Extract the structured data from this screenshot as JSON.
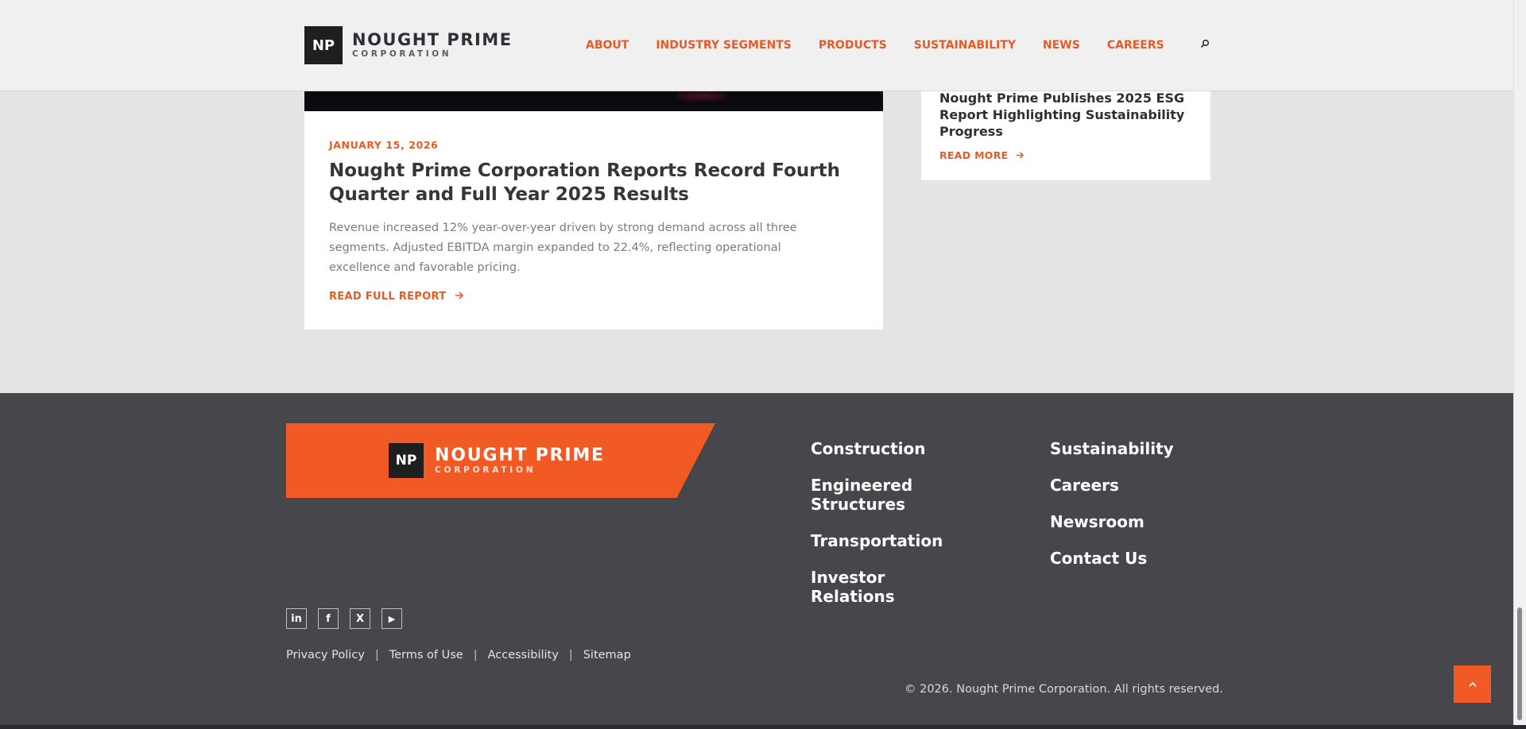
{
  "header": {
    "logo_mark": "NP",
    "logo_name": "NOUGHT PRIME",
    "logo_sub": "CORPORATION",
    "nav": [
      "ABOUT",
      "INDUSTRY SEGMENTS",
      "PRODUCTS",
      "SUSTAINABILITY",
      "NEWS",
      "CAREERS"
    ]
  },
  "featured": {
    "date": "JANUARY 15, 2026",
    "title": "Nought Prime Corporation Reports Record Fourth Quarter and Full Year 2025 Results",
    "excerpt": "Revenue increased 12% year-over-year driven by strong demand across all three segments. Adjusted EBITDA margin expanded to 22.4%, reflecting operational excellence and favorable pricing.",
    "link": "READ FULL REPORT"
  },
  "side": {
    "title": "Nought Prime Publishes 2025 ESG Report Highlighting Sustainability Progress",
    "link": "READ MORE"
  },
  "footer": {
    "logo_mark": "NP",
    "logo_name": "NOUGHT PRIME",
    "logo_sub": "CORPORATION",
    "col1": [
      "Construction",
      "Engineered Structures",
      "Transportation",
      "Investor Relations"
    ],
    "col2": [
      "Sustainability",
      "Careers",
      "Newsroom",
      "Contact Us"
    ],
    "social": [
      "in",
      "f",
      "X",
      "▶"
    ],
    "legal": [
      "Privacy Policy",
      "Terms of Use",
      "Accessibility",
      "Sitemap"
    ],
    "separator": "|",
    "copyright": "© 2026. Nought Prime Corporation. All rights reserved."
  },
  "colors": {
    "accent": "#f15a24",
    "footer_bg": "#47464b",
    "header_bg": "#f0f0f0"
  },
  "icons": {
    "search": "search-icon",
    "arrow": "arrow-right-icon",
    "to_top": "chevron-up-icon"
  }
}
